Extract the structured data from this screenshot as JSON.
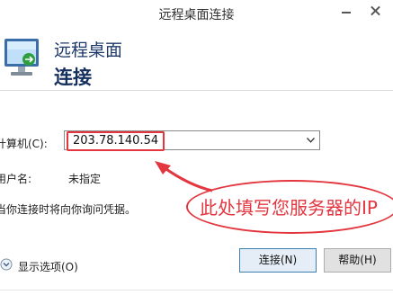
{
  "window": {
    "title": "远程桌面连接"
  },
  "header": {
    "title": "远程桌面",
    "subtitle": "连接"
  },
  "form": {
    "computer_label": "计算机(C):",
    "computer_value": "203.78.140.54",
    "username_label": "用户名:",
    "username_value": "未指定",
    "hint": "当你连接时将向你询问凭据。"
  },
  "annotation": {
    "text": "此处填写您服务器的IP",
    "color": "#e3363f"
  },
  "footer": {
    "options_label": "显示选项(O)",
    "connect_label": "连接(N)",
    "help_label": "帮助(H)"
  },
  "icons": {
    "minimize": "minimize-icon",
    "close": "close-icon",
    "app": "remote-desktop-icon",
    "dropdown": "chevron-down-icon",
    "options": "chevron-down-circle-icon"
  }
}
